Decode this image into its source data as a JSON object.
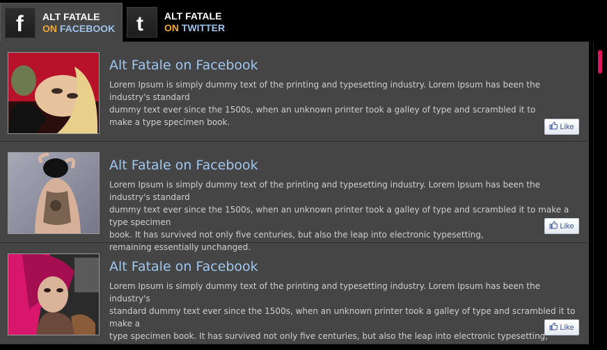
{
  "tabs": [
    {
      "line1": "ALT FATALE",
      "on": "ON",
      "network": "FACEBOOK",
      "icon": "facebook-icon",
      "active": true
    },
    {
      "line1": "ALT FATALE",
      "on": "ON",
      "network": "TWITTER",
      "icon": "twitter-icon",
      "active": false
    }
  ],
  "posts": [
    {
      "title": "Alt Fatale on Facebook",
      "body": "Lorem Ipsum is simply dummy text of the printing and typesetting industry. Lorem Ipsum has been the industry's standard\ndummy text ever since the 1500s, when an unknown printer took a galley of type and scrambled it to\nmake a type specimen book.",
      "like_label": "Like"
    },
    {
      "title": "Alt Fatale on Facebook",
      "body": "Lorem Ipsum is simply dummy text of the printing and typesetting industry. Lorem Ipsum has been the industry's standard\ndummy text ever since the 1500s, when an unknown printer took a galley of type and scrambled it to make a type specimen\nbook. It has survived not only five centuries, but also the leap into electronic typesetting,\nremaining essentially unchanged.",
      "like_label": "Like"
    },
    {
      "title": "Alt Fatale on Facebook",
      "body": "Lorem Ipsum is simply dummy text of the printing and typesetting industry. Lorem Ipsum has been the industry's\nstandard dummy text ever since the 1500s, when an unknown printer took a galley of type and scrambled it to make a\ntype specimen book. It has survived not only five centuries, but also the leap into electronic typesetting,\nremaining essentially unchanged.",
      "like_label": "Like"
    }
  ],
  "colors": {
    "accent_orange": "#f0a830",
    "link_blue": "#9fc7f0",
    "scroll_thumb": "#e0145e",
    "panel_bg": "#454545"
  }
}
